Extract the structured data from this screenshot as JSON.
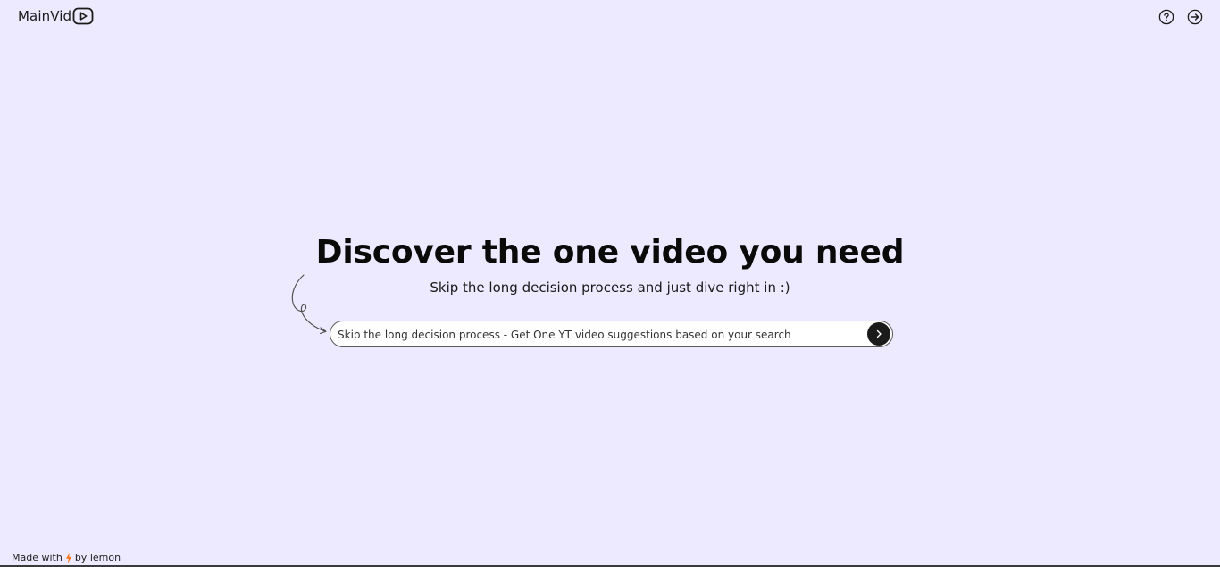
{
  "header": {
    "logo_text": "MainVid",
    "logo_icon": "play-icon",
    "actions": [
      {
        "icon": "help-icon"
      },
      {
        "icon": "sign-in-icon"
      }
    ]
  },
  "hero": {
    "headline": "Discover the one video you need",
    "subheadline": "Skip the long decision process and just dive right in :)"
  },
  "search": {
    "value": "Skip the long decision process - Get One YT video suggestions based on your search",
    "submit_icon": "chevron-right-icon"
  },
  "footer": {
    "prefix": "Made with",
    "icon": "lightning-icon",
    "suffix": "by lemon"
  },
  "colors": {
    "background": "#ede9fe",
    "accent_dark": "#1b1b1b",
    "lightning": "#f97316"
  }
}
